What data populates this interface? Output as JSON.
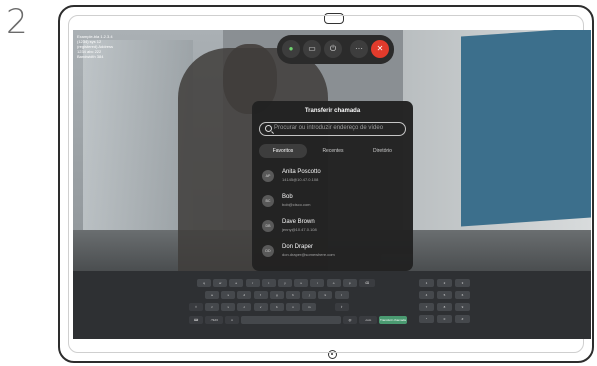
{
  "step_number": "2",
  "screen_info_text": "Example-bla 1.2.3.4 (1234) sys 12 (registered) Address 1234 abc 222 Bandwidth 384",
  "call_controls": [
    {
      "name": "mic-icon",
      "glyph": "●"
    },
    {
      "name": "camera-icon",
      "glyph": "▭"
    },
    {
      "name": "share-icon",
      "glyph": "⏻"
    },
    {
      "name": "more-icon",
      "glyph": "···"
    },
    {
      "name": "end-call-icon",
      "glyph": "✕"
    }
  ],
  "dialog": {
    "title": "Transferir chamada",
    "search_placeholder": "Procurar ou introduzir endereço de vídeo",
    "tabs": [
      "Favoritos",
      "Recentes",
      "Diretório"
    ],
    "contacts": [
      {
        "initials": "AP",
        "name": "Anita Poscotto",
        "address": "14145@10.47.0.108"
      },
      {
        "initials": "BC",
        "name": "Bob",
        "address": "bob@cisco.com"
      },
      {
        "initials": "DB",
        "name": "Dave Brown",
        "address": "jenny@10.47.0.108"
      },
      {
        "initials": "DD",
        "name": "Don Draper",
        "address": "don.draper@somewhere.com"
      }
    ]
  },
  "keyboard": {
    "row1": [
      "q",
      "w",
      "e",
      "r",
      "t",
      "y",
      "u",
      "i",
      "o",
      "p"
    ],
    "row2": [
      "a",
      "s",
      "d",
      "f",
      "g",
      "h",
      "j",
      "k",
      "l"
    ],
    "row3": [
      "z",
      "x",
      "c",
      "v",
      "b",
      "n",
      "m"
    ],
    "row4_left": ".?123",
    "row4_right": ".com",
    "action_key": "Transferir chamada",
    "numpad": [
      "1",
      "2",
      "3",
      "4",
      "5",
      "6",
      "7",
      "8",
      "9",
      "*",
      "0",
      "#"
    ]
  }
}
